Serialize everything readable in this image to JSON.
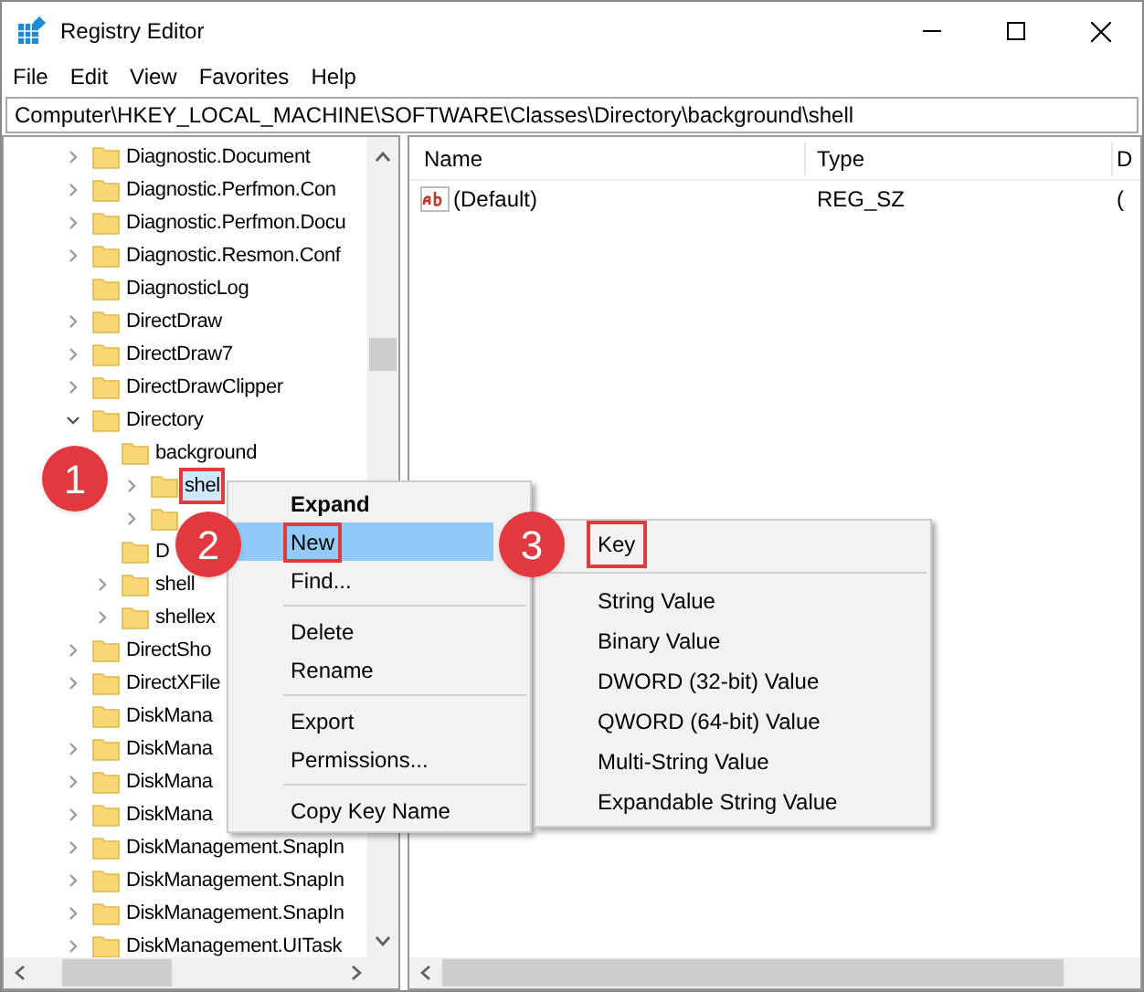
{
  "window": {
    "title": "Registry Editor"
  },
  "menu_bar": [
    "File",
    "Edit",
    "View",
    "Favorites",
    "Help"
  ],
  "address": "Computer\\HKEY_LOCAL_MACHINE\\SOFTWARE\\Classes\\Directory\\background\\shell",
  "tree": [
    {
      "label": "Diagnostic.Document",
      "expandable": true,
      "expanded": false
    },
    {
      "label": "Diagnostic.Perfmon.Con",
      "expandable": true,
      "expanded": false
    },
    {
      "label": "Diagnostic.Perfmon.Docu",
      "expandable": true,
      "expanded": false
    },
    {
      "label": "Diagnostic.Resmon.Conf",
      "expandable": true,
      "expanded": false
    },
    {
      "label": "DiagnosticLog"
    },
    {
      "label": "DirectDraw",
      "expandable": true,
      "expanded": false
    },
    {
      "label": "DirectDraw7",
      "expandable": true,
      "expanded": false
    },
    {
      "label": "DirectDrawClipper",
      "expandable": true,
      "expanded": false
    },
    {
      "label": "Directory",
      "expandable": true,
      "expanded": true,
      "children": [
        {
          "label": "background",
          "children": [
            {
              "label": "shel",
              "expandable": true,
              "expanded": false,
              "selected": true,
              "outlined": true
            },
            {
              "expandable": true,
              "expanded": false
            }
          ]
        },
        {
          "label": "D"
        },
        {
          "label": "shell",
          "expandable": true,
          "expanded": false
        },
        {
          "label": "shellex",
          "expandable": true,
          "expanded": false
        }
      ]
    },
    {
      "label": "DirectSho",
      "expandable": true,
      "expanded": false
    },
    {
      "label": "DirectXFile",
      "expandable": true,
      "expanded": false
    },
    {
      "label": "DiskMana"
    },
    {
      "label": "DiskMana",
      "expandable": true,
      "expanded": false
    },
    {
      "label": "DiskMana",
      "expandable": true,
      "expanded": false
    },
    {
      "label": "DiskMana",
      "expandable": true,
      "expanded": false
    },
    {
      "label": "DiskManagement.SnapIn",
      "expandable": true,
      "expanded": false
    },
    {
      "label": "DiskManagement.SnapIn",
      "expandable": true,
      "expanded": false
    },
    {
      "label": "DiskManagement.SnapIn",
      "expandable": true,
      "expanded": false
    },
    {
      "label": "DiskManagement.UITask",
      "expandable": true,
      "expanded": false
    }
  ],
  "values_table": {
    "columns": [
      "Name",
      "Type",
      "D"
    ],
    "rows": [
      {
        "name": "(Default)",
        "type": "REG_SZ",
        "column_3": "("
      }
    ]
  },
  "context_menu": [
    {
      "kind": "item",
      "label": "Expand",
      "bold": true,
      "selected": false,
      "outlined": false
    },
    {
      "kind": "item",
      "label": "New",
      "bold": false,
      "selected": true,
      "outlined": true
    },
    {
      "kind": "item",
      "label": "Find...",
      "bold": false,
      "selected": false,
      "outlined": false
    },
    {
      "kind": "separator"
    },
    {
      "kind": "item",
      "label": "Delete",
      "bold": false,
      "selected": false,
      "outlined": false
    },
    {
      "kind": "item",
      "label": "Rename",
      "bold": false,
      "selected": false,
      "outlined": false
    },
    {
      "kind": "separator"
    },
    {
      "kind": "item",
      "label": "Export",
      "bold": false,
      "selected": false,
      "outlined": false
    },
    {
      "kind": "item",
      "label": "Permissions...",
      "bold": false,
      "selected": false,
      "outlined": false
    },
    {
      "kind": "separator"
    },
    {
      "kind": "item",
      "label": "Copy Key Name",
      "bold": false,
      "selected": false,
      "outlined": false
    }
  ],
  "submenu": [
    {
      "kind": "item",
      "label": "Key",
      "outlined": true
    },
    {
      "kind": "separator"
    },
    {
      "kind": "item",
      "label": "String Value",
      "outlined": false
    },
    {
      "kind": "item",
      "label": "Binary Value",
      "outlined": false
    },
    {
      "kind": "item",
      "label": "DWORD (32-bit) Value",
      "outlined": false
    },
    {
      "kind": "item",
      "label": "QWORD (64-bit) Value",
      "outlined": false
    },
    {
      "kind": "item",
      "label": "Multi-String Value",
      "outlined": false
    },
    {
      "kind": "item",
      "label": "Expandable String Value",
      "outlined": false
    }
  ],
  "step_badges": [
    "1",
    "2",
    "3"
  ]
}
